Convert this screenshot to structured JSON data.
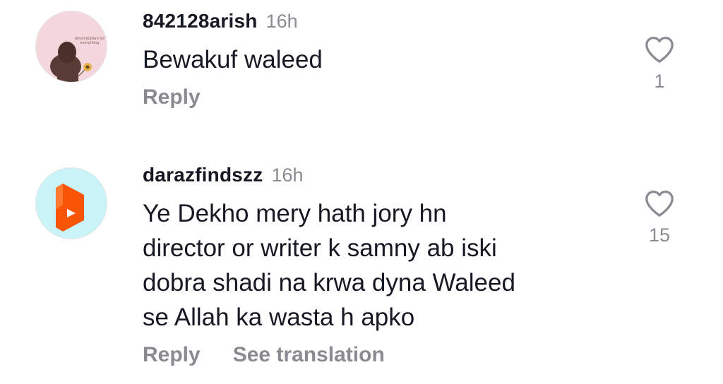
{
  "comments": [
    {
      "username": "842128arish",
      "time": "16h",
      "text": "Bewakuf waleed",
      "reply_label": "Reply",
      "like_count": "1",
      "avatar_caption": "Alhamdulillah for everything"
    },
    {
      "username": "darazfindszz",
      "time": "16h",
      "text": "Ye Dekho mery hath jory hn\ndirector or writer k samny ab iski\ndobra shadi na krwa dyna Waleed\nse Allah ka wasta h apko",
      "reply_label": "Reply",
      "translate_label": "See translation",
      "like_count": "15"
    }
  ],
  "colors": {
    "text": "#161823",
    "muted": "#8a8b91",
    "daraz_orange": "#f85606",
    "daraz_bg": "#c9f3f6",
    "avatar1_bg": "#f4d7dc"
  }
}
